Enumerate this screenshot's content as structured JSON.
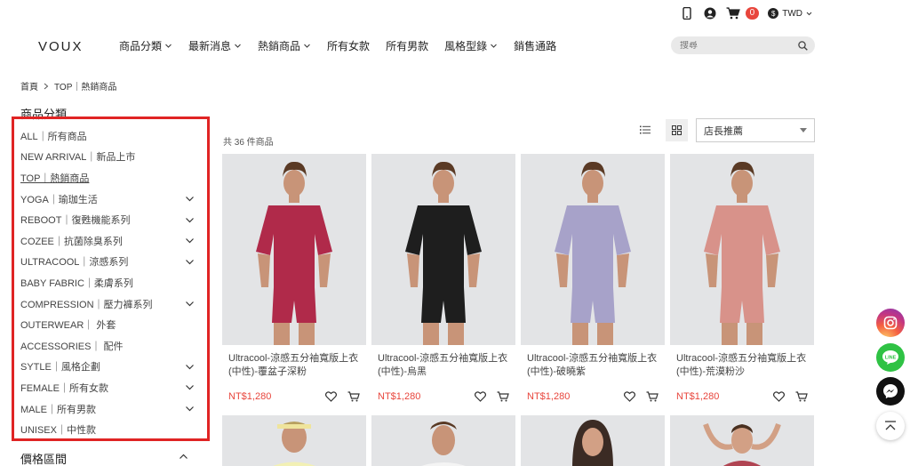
{
  "utility": {
    "cart_count": "0",
    "currency": "TWD"
  },
  "header": {
    "logo": "VOUX",
    "nav": [
      {
        "label": "商品分類",
        "has_dropdown": true
      },
      {
        "label": "最新消息",
        "has_dropdown": true
      },
      {
        "label": "熱銷商品",
        "has_dropdown": true
      },
      {
        "label": "所有女款",
        "has_dropdown": false
      },
      {
        "label": "所有男款",
        "has_dropdown": false
      },
      {
        "label": "風格型錄",
        "has_dropdown": true
      },
      {
        "label": "銷售通路",
        "has_dropdown": false
      }
    ],
    "search_placeholder": "搜尋"
  },
  "breadcrumb": {
    "home": "首頁",
    "current": "TOP｜熱銷商品"
  },
  "sidebar": {
    "title": "商品分類",
    "categories": [
      {
        "label": "ALL｜所有商品",
        "expandable": false
      },
      {
        "label": "NEW ARRIVAL｜新品上市",
        "expandable": false
      },
      {
        "label": "TOP｜熱銷商品",
        "expandable": false,
        "active": true
      },
      {
        "label": "YOGA｜瑜珈生活",
        "expandable": true
      },
      {
        "label": "REBOOT｜復甦機能系列",
        "expandable": true
      },
      {
        "label": "COZEE｜抗菌除臭系列",
        "expandable": true
      },
      {
        "label": "ULTRACOOL｜涼感系列",
        "expandable": true
      },
      {
        "label": "BABY FABRIC｜柔膚系列",
        "expandable": false
      },
      {
        "label": "COMPRESSION｜壓力褲系列",
        "expandable": true
      },
      {
        "label": "OUTERWEAR｜ 外套",
        "expandable": false
      },
      {
        "label": "ACCESSORIES｜ 配件",
        "expandable": false
      },
      {
        "label": "SYTLE｜風格企劃",
        "expandable": true
      },
      {
        "label": "FEMALE｜所有女款",
        "expandable": true
      },
      {
        "label": "MALE｜所有男款",
        "expandable": true
      },
      {
        "label": "UNISEX｜中性款",
        "expandable": false
      }
    ],
    "price_title": "價格區間"
  },
  "toolbar": {
    "count": "共 36 件商品",
    "sort_selected": "店長推薦"
  },
  "products": [
    {
      "name": "Ultracool-涼感五分袖寬版上衣(中性)-覆盆子深粉",
      "price": "NT$1,280",
      "shirt_color": "#b02a4a"
    },
    {
      "name": "Ultracool-涼感五分袖寬版上衣(中性)-烏黑",
      "price": "NT$1,280",
      "shirt_color": "#1e1e1e"
    },
    {
      "name": "Ultracool-涼感五分袖寬版上衣(中性)-破曉紫",
      "price": "NT$1,280",
      "shirt_color": "#a7a2c9"
    },
    {
      "name": "Ultracool-涼感五分袖寬版上衣(中性)-荒漠粉沙",
      "price": "NT$1,280",
      "shirt_color": "#d8928a"
    }
  ],
  "colors": {
    "accent_red": "#e02424",
    "price_red": "#e8453c"
  }
}
